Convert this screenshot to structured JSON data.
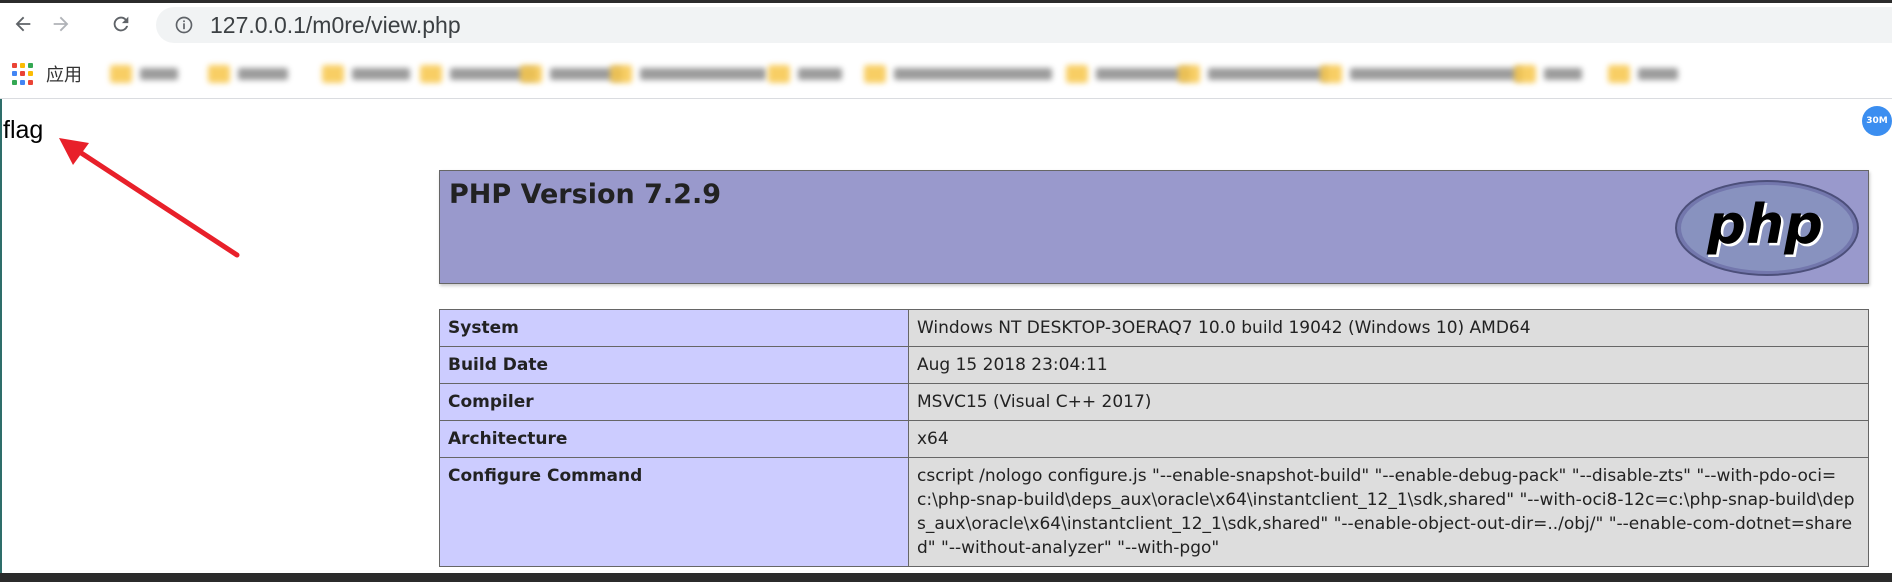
{
  "browser": {
    "url": "127.0.0.1/m0re/view.php",
    "apps_label": "应用",
    "extension_badge": "30M",
    "icons": {
      "back": "back-arrow-icon",
      "forward": "forward-arrow-icon",
      "reload": "reload-icon",
      "info": "info-icon",
      "apps": "apps-grid-icon"
    }
  },
  "page": {
    "flag_text": "flag",
    "annotation": "red-arrow-pointing-to-flag"
  },
  "phpinfo": {
    "title": "PHP Version 7.2.9",
    "logo_text": "php",
    "rows": [
      {
        "key": "System",
        "value": "Windows NT DESKTOP-3OERAQ7 10.0 build 19042 (Windows 10) AMD64"
      },
      {
        "key": "Build Date",
        "value": "Aug 15 2018 23:04:11"
      },
      {
        "key": "Compiler",
        "value": "MSVC15 (Visual C++ 2017)"
      },
      {
        "key": "Architecture",
        "value": "x64"
      },
      {
        "key": "Configure Command",
        "value": "cscript /nologo configure.js \"--enable-snapshot-build\" \"--enable-debug-pack\" \"--disable-zts\" \"--with-pdo-oci=c:\\php-snap-build\\deps_aux\\oracle\\x64\\instantclient_12_1\\sdk,shared\" \"--with-oci8-12c=c:\\php-snap-build\\deps_aux\\oracle\\x64\\instantclient_12_1\\sdk,shared\" \"--enable-object-out-dir=../obj/\" \"--enable-com-dotnet=shared\" \"--without-analyzer\" \"--with-pgo\""
      }
    ]
  },
  "colors": {
    "php_header_bg": "#9999cc",
    "key_cell_bg": "#ccccff",
    "value_cell_bg": "#dddddd",
    "arrow": "#e8202a"
  }
}
